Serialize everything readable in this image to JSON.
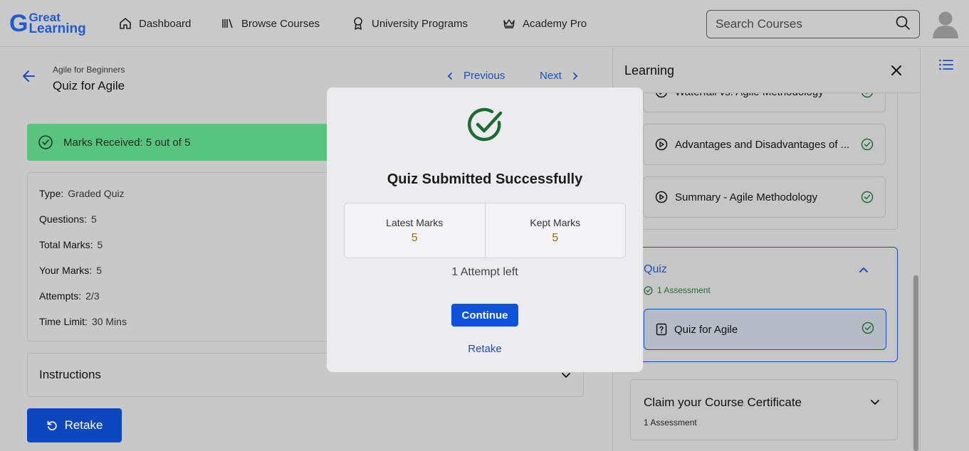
{
  "header": {
    "logo_top": "Great",
    "logo_bottom": "Learning",
    "nav": [
      {
        "label": "Dashboard",
        "icon": "home-icon"
      },
      {
        "label": "Browse Courses",
        "icon": "library-icon"
      },
      {
        "label": "University Programs",
        "icon": "award-icon"
      },
      {
        "label": "Academy Pro",
        "icon": "crown-icon"
      }
    ],
    "search_placeholder": "Search Courses"
  },
  "content": {
    "breadcrumb": "Agile for Beginners",
    "title": "Quiz for Agile",
    "previous_label": "Previous",
    "next_label": "Next",
    "marks_banner": "Marks Received: 5 out of 5",
    "info": [
      {
        "label": "Type:",
        "value": "Graded Quiz"
      },
      {
        "label": "Questions:",
        "value": "5"
      },
      {
        "label": "Total Marks:",
        "value": "5"
      },
      {
        "label": "Your Marks:",
        "value": "5"
      },
      {
        "label": "Attempts:",
        "value": "2/3"
      },
      {
        "label": "Time Limit:",
        "value": "30 Mins"
      }
    ],
    "instructions_label": "Instructions",
    "retake_label": "Retake"
  },
  "learning_panel": {
    "title": "Learning",
    "lessons": [
      {
        "label": "Waterfall vs. Agile Methodology"
      },
      {
        "label": "Advantages and Disadvantages of ..."
      },
      {
        "label": "Summary - Agile Methodology"
      }
    ],
    "quiz": {
      "title": "Quiz",
      "subtitle": "1 Assessment",
      "item": "Quiz for Agile"
    },
    "certificate": {
      "title": "Claim your Course Certificate",
      "subtitle": "1 Assessment"
    }
  },
  "modal": {
    "title": "Quiz Submitted Successfully",
    "latest_label": "Latest Marks",
    "latest_value": "5",
    "kept_label": "Kept Marks",
    "kept_value": "5",
    "attempt_text": "1 Attempt left",
    "continue_label": "Continue",
    "retake_label": "Retake"
  },
  "colors": {
    "accent_blue": "#1b4fbf",
    "success_green": "#58c47e",
    "marks_value": "#9a6b12"
  }
}
